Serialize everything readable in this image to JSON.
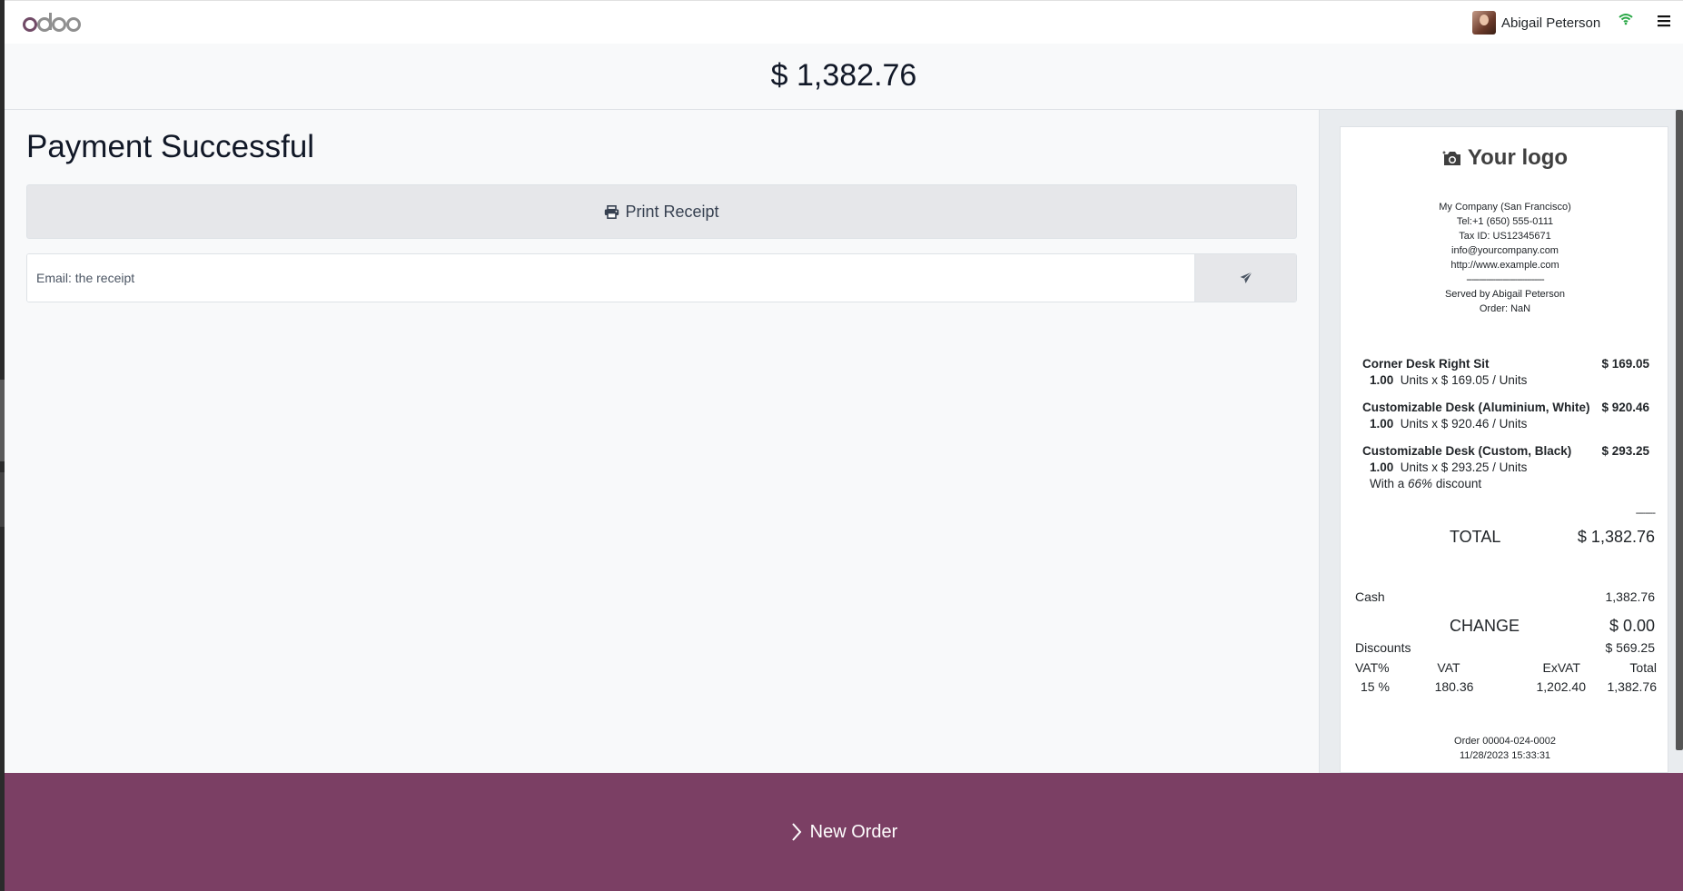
{
  "topbar": {
    "user_name": "Abigail Peterson"
  },
  "amount": "$ 1,382.76",
  "main": {
    "title": "Payment Successful",
    "print_label": "Print Receipt",
    "email_placeholder": "Email: the receipt"
  },
  "receipt": {
    "logo_text": "Your logo",
    "header": {
      "company": "My Company (San Francisco)",
      "tel": "Tel:+1 (650) 555-0111",
      "tax_id": "Tax ID: US12345671",
      "email": "info@yourcompany.com",
      "website": "http://www.example.com",
      "separator": "--------------------------------",
      "served_by": "Served by Abigail Peterson",
      "order": "Order: NaN"
    },
    "lines": [
      {
        "name": "Corner Desk Right Sit",
        "price": "$ 169.05",
        "qty": "1.00",
        "unit": "Units x $ 169.05 / Units"
      },
      {
        "name": "Customizable Desk (Aluminium, White)",
        "price": "$ 920.46",
        "qty": "1.00",
        "unit": "Units x $ 920.46 / Units"
      },
      {
        "name": "Customizable Desk (Custom, Black)",
        "price": "$ 293.25",
        "qty": "1.00",
        "unit": "Units x $ 293.25 / Units",
        "discount_prefix": "With a",
        "discount_value": "66%",
        "discount_suffix": "discount"
      }
    ],
    "total_separator": "--------",
    "total_label": "TOTAL",
    "total_value": "$ 1,382.76",
    "cash_label": "Cash",
    "cash_value": "1,382.76",
    "change_label": "CHANGE",
    "change_value": "$ 0.00",
    "discounts_label": "Discounts",
    "discounts_value": "$ 569.25",
    "tax_headers": [
      "VAT%",
      "VAT",
      "ExVAT",
      "Total"
    ],
    "tax_row": [
      "15 %",
      "180.36",
      "1,202.40",
      "1,382.76"
    ],
    "footer_order": "Order 00004-024-0002",
    "footer_date": "11/28/2023 15:33:31"
  },
  "new_order_label": "New Order",
  "colors": {
    "brand": "#7b3f64",
    "wifi": "#28a745"
  },
  "icons": [
    "odoo-logo",
    "wifi-icon",
    "hamburger-menu-icon",
    "printer-icon",
    "paper-plane-icon",
    "camera-icon",
    "chevron-right-icon"
  ]
}
